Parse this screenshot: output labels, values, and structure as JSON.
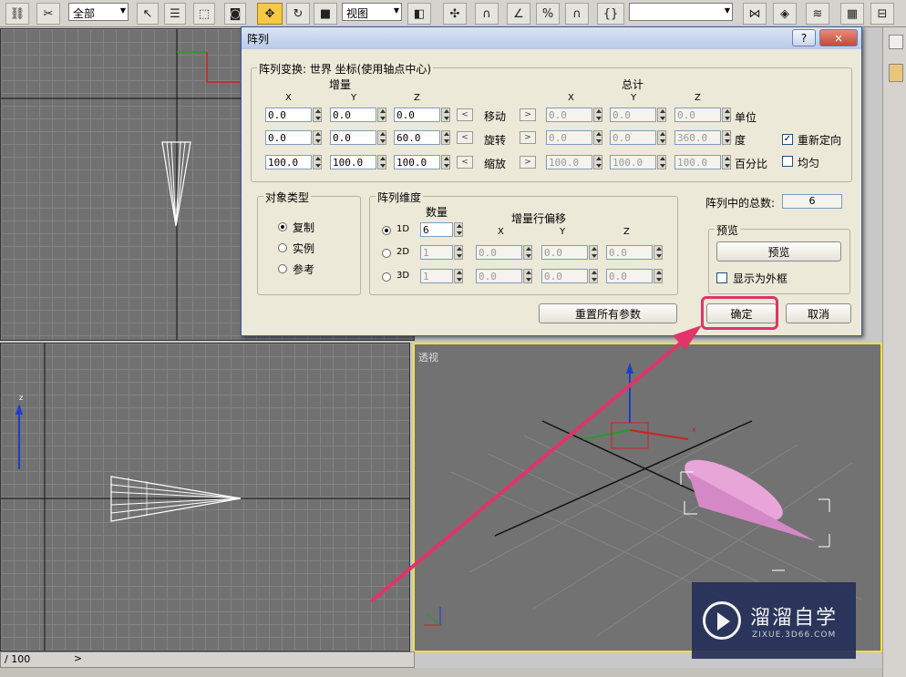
{
  "toolbar": {
    "selection_filter": "全部",
    "coord_system": "视图"
  },
  "viewports": {
    "perspective_label": "透视",
    "axis_z": "z",
    "axis_x": "x"
  },
  "timeline": {
    "frame_display": "/ 100",
    "next": ">"
  },
  "dialog": {
    "title": "阵列",
    "help": "?",
    "close": "×",
    "transform_group": "阵列变换: 世界 坐标(使用轴点中心)",
    "increment_label": "增量",
    "totals_label": "总计",
    "col_x": "X",
    "col_y": "Y",
    "col_z": "Z",
    "rows": [
      {
        "inc": [
          "0.0",
          "0.0",
          "0.0"
        ],
        "label": "移动",
        "tot": [
          "0.0",
          "0.0",
          "0.0"
        ],
        "unit": "单位"
      },
      {
        "inc": [
          "0.0",
          "0.0",
          "60.0"
        ],
        "label": "旋转",
        "tot": [
          "0.0",
          "0.0",
          "360.0"
        ],
        "unit": "度"
      },
      {
        "inc": [
          "100.0",
          "100.0",
          "100.0"
        ],
        "label": "缩放",
        "tot": [
          "100.0",
          "100.0",
          "100.0"
        ],
        "unit": "百分比"
      }
    ],
    "left_arrow": "<",
    "right_arrow": ">",
    "reorient_label": "重新定向",
    "reorient_checked": "✓",
    "uniform_label": "均匀",
    "object_type_group": "对象类型",
    "object_types": [
      "复制",
      "实例",
      "参考"
    ],
    "dimensions_group": "阵列维度",
    "count_label": "数量",
    "incremental_row_offsets": "增量行偏移",
    "dims": [
      {
        "label": "1D",
        "count": "6"
      },
      {
        "label": "2D",
        "count": "1",
        "x": "0.0",
        "y": "0.0",
        "z": "0.0"
      },
      {
        "label": "3D",
        "count": "1",
        "x": "0.0",
        "y": "0.0",
        "z": "0.0"
      }
    ],
    "total_in_array_label": "阵列中的总数:",
    "total_in_array": "6",
    "preview_group": "预览",
    "preview_button": "预览",
    "display_as_box": "显示为外框",
    "reset_button": "重置所有参数",
    "ok_button": "确定",
    "cancel_button": "取消"
  },
  "watermark": {
    "title": "溜溜自学",
    "url": "ZIXUE.3D66.COM"
  },
  "colors": {
    "highlight": "#e0346a",
    "active_viewport": "#f0e13a",
    "cone": "#e8a5d8"
  }
}
